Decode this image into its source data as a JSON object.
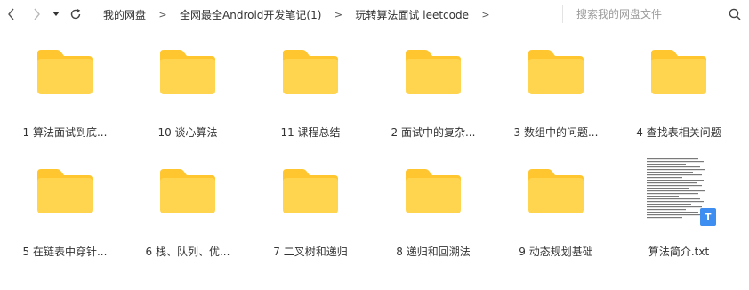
{
  "toolbar": {
    "back_icon": "chevron-left-icon",
    "forward_icon": "chevron-right-icon",
    "history_icon": "caret-down-icon",
    "refresh_icon": "refresh-icon",
    "breadcrumb": [
      "我的网盘",
      "全网最全Android开发笔记(1)",
      "玩转算法面试 leetcode"
    ],
    "separator": ">",
    "search_placeholder": "搜索我的网盘文件",
    "search_icon": "search-icon"
  },
  "colors": {
    "folder_body": "#FFD54F",
    "folder_tab": "#FFC62F",
    "badge": "#3D8EF0",
    "text": "#333333",
    "placeholder": "#9A9A9A"
  },
  "files": [
    {
      "label": "1 算法面试到底...",
      "type": "folder"
    },
    {
      "label": "10 谈心算法",
      "type": "folder"
    },
    {
      "label": "11 课程总结",
      "type": "folder"
    },
    {
      "label": "2 面试中的复杂...",
      "type": "folder"
    },
    {
      "label": "3 数组中的问题...",
      "type": "folder"
    },
    {
      "label": "4 查找表相关问题",
      "type": "folder"
    },
    {
      "label": "5 在链表中穿针...",
      "type": "folder"
    },
    {
      "label": "6 栈、队列、优...",
      "type": "folder"
    },
    {
      "label": "7 二叉树和递归",
      "type": "folder"
    },
    {
      "label": "8 递归和回溯法",
      "type": "folder"
    },
    {
      "label": "9 动态规划基础",
      "type": "folder"
    },
    {
      "label": "算法简介.txt",
      "type": "txt",
      "badge": "T"
    }
  ]
}
